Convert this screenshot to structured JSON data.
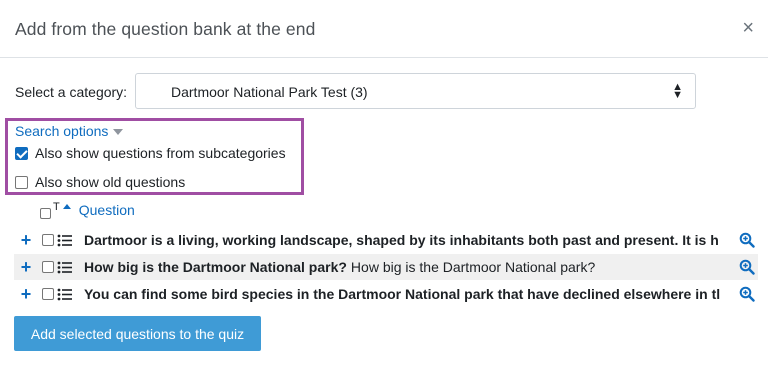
{
  "dialog": {
    "title": "Add from the question bank at the end",
    "close_symbol": "×"
  },
  "category": {
    "label": "Select a category:",
    "selected": "Dartmoor National Park Test (3)",
    "caret": "⬍"
  },
  "search_options": {
    "label": "Search options",
    "subcategories": {
      "label": "Also show questions from subcategories",
      "checked": true
    },
    "old_questions": {
      "label": "Also show old questions",
      "checked": false
    }
  },
  "table": {
    "header": {
      "type_label": "T",
      "question_label": "Question"
    },
    "rows": [
      {
        "name": "Dartmoor is a living, working landscape, shaped by its inhabitants both past and present. It is h",
        "text": ""
      },
      {
        "name": "How big is the Dartmoor National park?",
        "text": "How big is the Dartmoor National park?"
      },
      {
        "name": "You can find some bird species in the Dartmoor National park that have declined elsewhere in tl",
        "text": ""
      }
    ]
  },
  "actions": {
    "add_selected_label": "Add selected questions to the quiz"
  },
  "colors": {
    "accent": "#0f6cbf",
    "button": "#3f9bd6",
    "highlight": "#a04ea3"
  },
  "icons": {
    "add": "plus-icon",
    "question_type": "multichoice-icon",
    "preview": "zoom-in-icon",
    "sort": "sort-asc-icon"
  }
}
